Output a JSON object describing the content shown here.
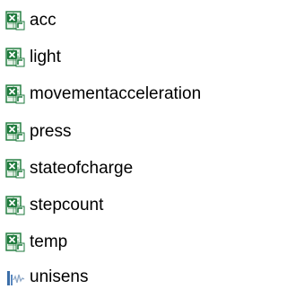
{
  "files": [
    {
      "label": "acc",
      "icon": "excel-csv-icon"
    },
    {
      "label": "light",
      "icon": "excel-csv-icon"
    },
    {
      "label": "movementacceleration",
      "icon": "excel-csv-icon"
    },
    {
      "label": "press",
      "icon": "excel-csv-icon"
    },
    {
      "label": "stateofcharge",
      "icon": "excel-csv-icon"
    },
    {
      "label": "stepcount",
      "icon": "excel-csv-icon"
    },
    {
      "label": "temp",
      "icon": "excel-csv-icon"
    },
    {
      "label": "unisens",
      "icon": "unisens-waveform-icon"
    }
  ],
  "colors": {
    "excel_green": "#1e7a3c",
    "excel_light": "#e8f3ea",
    "unisens_blue": "#3b6ea8"
  }
}
